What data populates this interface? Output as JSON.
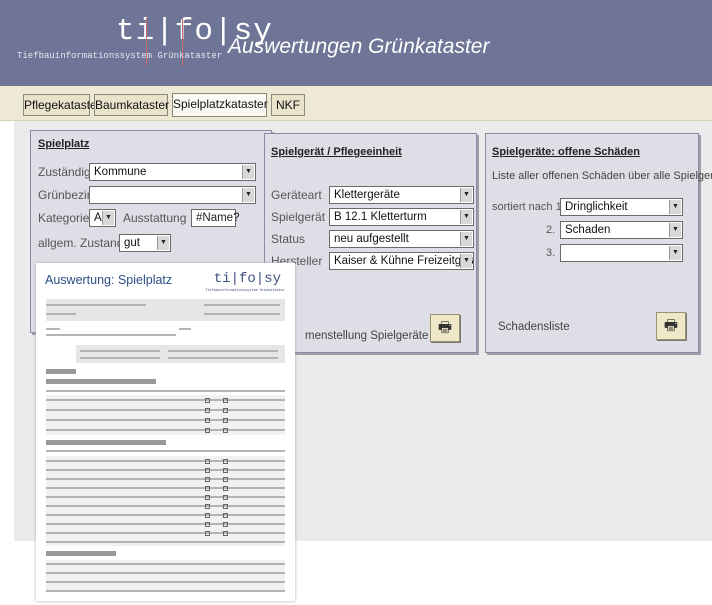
{
  "header": {
    "logo": "ti|fo|sy",
    "logo_sub": "Tiefbauinformationssystem Grünkataster",
    "title": "Auswertungen Grünkataster"
  },
  "tabs": [
    {
      "label": "Pflegekataster",
      "active": false
    },
    {
      "label": "Baumkataster",
      "active": false
    },
    {
      "label": "Spielplatzkataster",
      "active": true
    },
    {
      "label": "NKF",
      "active": false
    }
  ],
  "spielplatz": {
    "title": "Spielplatz",
    "zustaendig_label": "Zuständig",
    "zustaendig_value": "Kommune",
    "gruenbezirk_label": "Grünbezirk",
    "gruenbezirk_value": "",
    "kategorie_label": "Kategorie",
    "kategorie_value": "A",
    "ausstattung_label": "Ausstattung",
    "ausstattung_value": "#Name?",
    "zustand_label": "allgem. Zustand",
    "zustand_value": "gut"
  },
  "spielgeraet": {
    "title": "Spielgerät / Pflegeeinheit",
    "geraeteart_label": "Geräteart",
    "geraeteart_value": "Klettergeräte",
    "spielgeraet_label": "Spielgerät",
    "spielgeraet_value": "B 12.1 Kletterturm",
    "status_label": "Status",
    "status_value": "neu aufgestellt",
    "hersteller_label": "Hersteller",
    "hersteller_value": "Kaiser & Kühne Freizeitgeräte Gm",
    "zusammenstellung": "menstellung Spielgeräte"
  },
  "schaeden": {
    "title": "Spielgeräte: offene Schäden",
    "description": "Liste aller offenen Schäden über alle Spielgeräte",
    "sort_label": "sortiert nach 1.",
    "sort1": "Dringlichkeit",
    "sort2_label": "2.",
    "sort2": "Schaden",
    "sort3_label": "3.",
    "sort3": "",
    "list_label": "Schadensliste"
  },
  "report": {
    "title": "Auswertung: Spielplatz",
    "logo": "ti|fo|sy",
    "logo_sub": "Tiefbauinformationssystem  Grünkataster"
  },
  "icons": {
    "print": "printer-icon",
    "dropdown": "chevron-down-icon"
  },
  "colors": {
    "header_bg": "#6e7596",
    "tabbar_bg": "#eee9d4",
    "panel_bg": "#dedee6",
    "report_accent": "#2a4f86"
  }
}
